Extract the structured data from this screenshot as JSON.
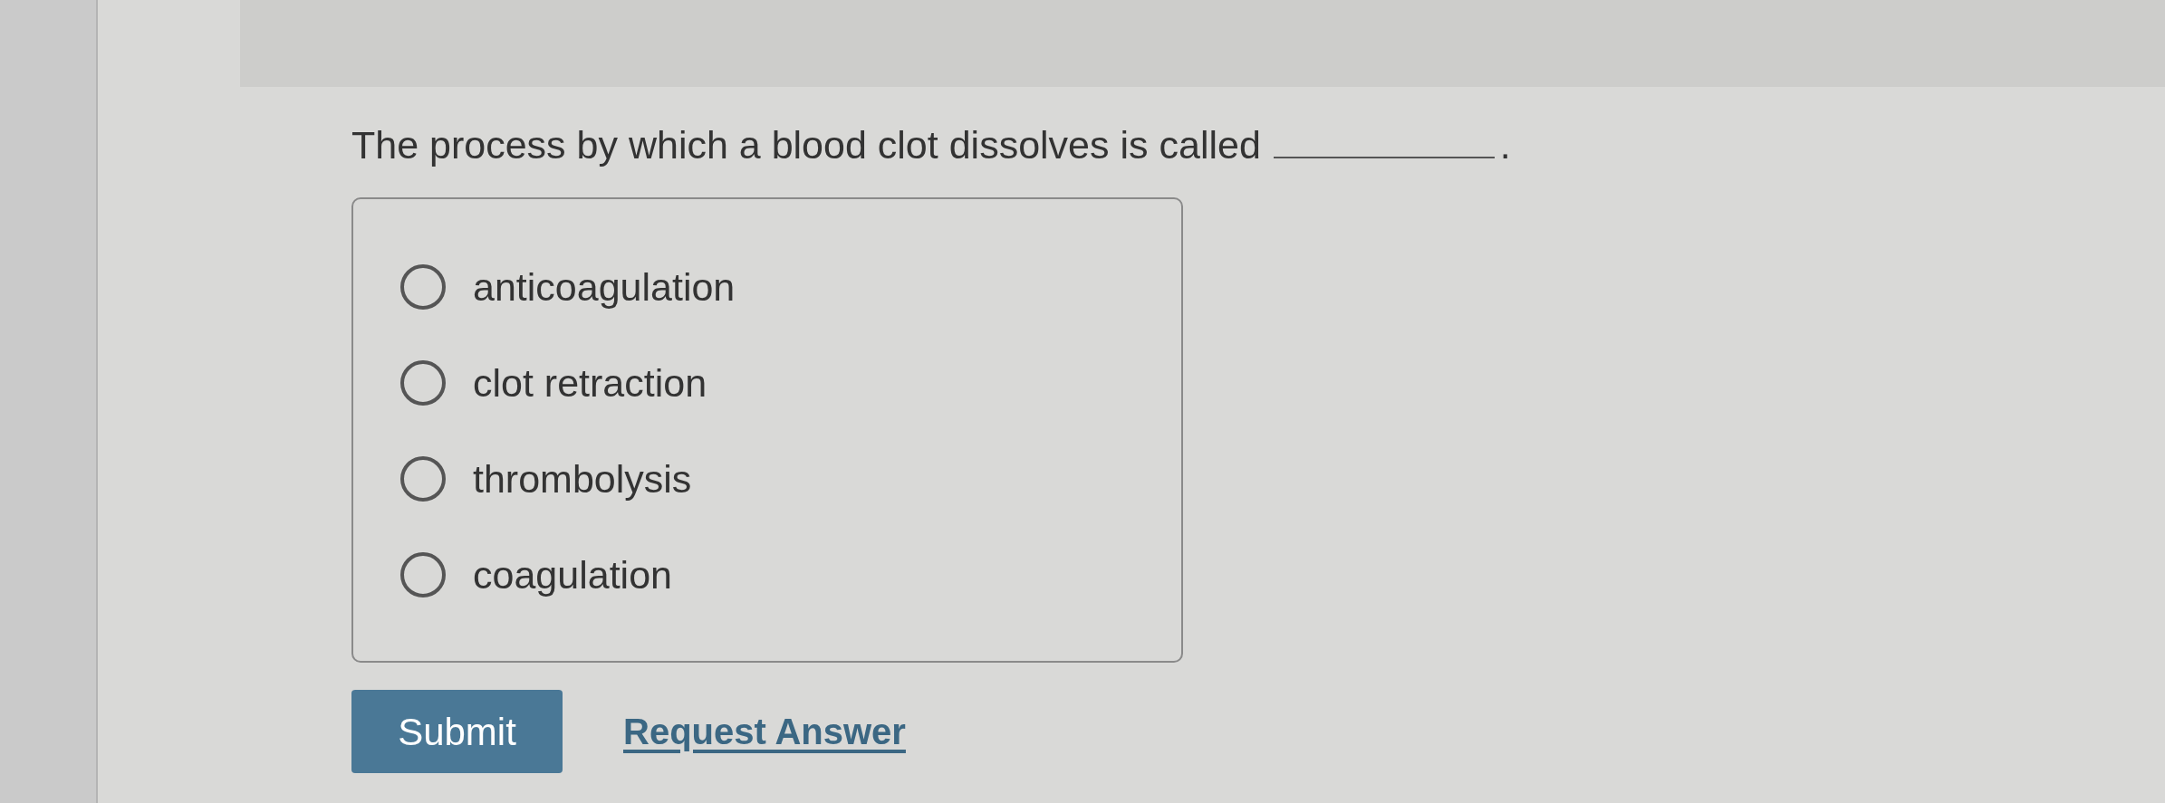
{
  "question": {
    "parts": [
      {
        "kind": "text",
        "text": "The process by which a blood clot dissolves is called"
      },
      {
        "kind": "blank"
      },
      {
        "kind": "text",
        "text": "."
      }
    ]
  },
  "options": [
    {
      "label": "anticoagulation",
      "selected": false
    },
    {
      "label": "clot retraction",
      "selected": false
    },
    {
      "label": "thrombolysis",
      "selected": false
    },
    {
      "label": "coagulation",
      "selected": false
    }
  ],
  "actions": [
    {
      "kind": "button",
      "label": "Submit"
    },
    {
      "kind": "link",
      "label": "Request Answer"
    }
  ]
}
